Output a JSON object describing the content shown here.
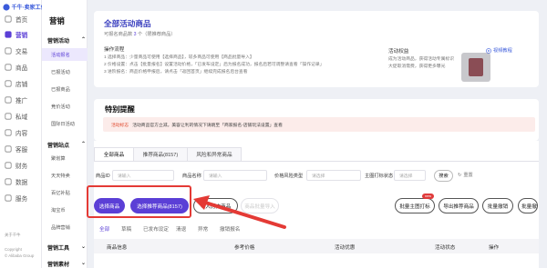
{
  "brand": {
    "logo_text": "千牛·卖家工作台"
  },
  "rail": {
    "items": [
      {
        "label": "首页",
        "icon": "home-icon"
      },
      {
        "label": "营销",
        "icon": "megaphone-icon",
        "active": true
      },
      {
        "label": "交易",
        "icon": "order-icon"
      },
      {
        "label": "商品",
        "icon": "box-icon"
      },
      {
        "label": "店铺",
        "icon": "store-icon"
      },
      {
        "label": "推广",
        "icon": "promo-icon"
      },
      {
        "label": "私域",
        "icon": "people-icon"
      },
      {
        "label": "内容",
        "icon": "content-icon"
      },
      {
        "label": "客服",
        "icon": "service-icon"
      },
      {
        "label": "财务",
        "icon": "wallet-icon"
      },
      {
        "label": "数据",
        "icon": "chart-icon"
      },
      {
        "label": "服务",
        "icon": "grid-icon"
      }
    ],
    "footer": [
      "关于千牛",
      "Copyright",
      "© Alibaba Group"
    ]
  },
  "submenu": {
    "title": "营销",
    "section1": "营销活动",
    "items1": [
      {
        "label": "活动报名",
        "active": true
      },
      {
        "label": "已报活动"
      },
      {
        "label": "已报商品"
      },
      {
        "label": "竞价活动"
      },
      {
        "label": "国际日活动"
      }
    ],
    "section2": "营销站点",
    "items2": [
      {
        "label": "聚划算"
      },
      {
        "label": "天天特卖"
      },
      {
        "label": "百亿补贴"
      },
      {
        "label": "淘宝币"
      },
      {
        "label": "品牌营销"
      }
    ],
    "section3": "营销工具",
    "section4": "营销素材"
  },
  "header_card": {
    "title": "全部活动商品",
    "count_prefix": "可报名商品数",
    "count_value": "3",
    "count_suffix": "个（限推荐商品）",
    "process_title": "操作流程",
    "process": [
      "1  选择商品：少量商品可使用【选择商品】，较多商品可使用【商品批量导入】",
      "2  价格设置：点击【批量报名】设置活动价格，「已发布设定」后为报名成功，报名后若可调整请查看「操作记录」",
      "3  进阶报名：商品价格申报后，请点击「返回首页」继续完成报名后台查看"
    ],
    "rights_title": "活动权益",
    "rights": [
      "成为活动商品，获得活动专属标识",
      "大促取消需费，获得更多曝光"
    ],
    "video_link": "视频教程"
  },
  "notice_card": {
    "title": "特别提醒",
    "label": "活动标志",
    "text": "活动商品官方立减。美容让利的情况下请跳至「商家报名-店铺玩法设置」查看"
  },
  "tabs": [
    "全部商品",
    "推荐商品(8157)",
    "风险和异常商品"
  ],
  "filters": {
    "product_id": {
      "label": "商品ID",
      "placeholder": "请输入"
    },
    "product_name": {
      "label": "商品名称",
      "placeholder": "请输入"
    },
    "price_risk": {
      "label": "价格风险类型",
      "placeholder": "请选择"
    },
    "main_img": {
      "label": "主图打标状态",
      "placeholder": "请选择"
    },
    "search": "搜索",
    "reset": "重置"
  },
  "actions": {
    "select": "选择商品",
    "select_recommended": "选择推荐商品(8157)",
    "import_history": "导入历史商品",
    "batch_import": "商品批量导入",
    "batch_main_img": "批量主图打标",
    "new_badge": "new",
    "export_recommended": "导出推荐商品",
    "batch_revoke": "批量撤销",
    "batch_revoke_img": "批量撤销主图打标"
  },
  "status_tabs": [
    "全部",
    "草稿",
    "已发布设定",
    "清退",
    "异常",
    "撤销报名"
  ],
  "table_headers": {
    "info": "商品信息",
    "price": "参考价格",
    "promo": "活动优惠",
    "status": "活动状态",
    "op": "操作"
  },
  "colors": {
    "accent": "#5b3fd6",
    "highlight": "#e43a35"
  }
}
